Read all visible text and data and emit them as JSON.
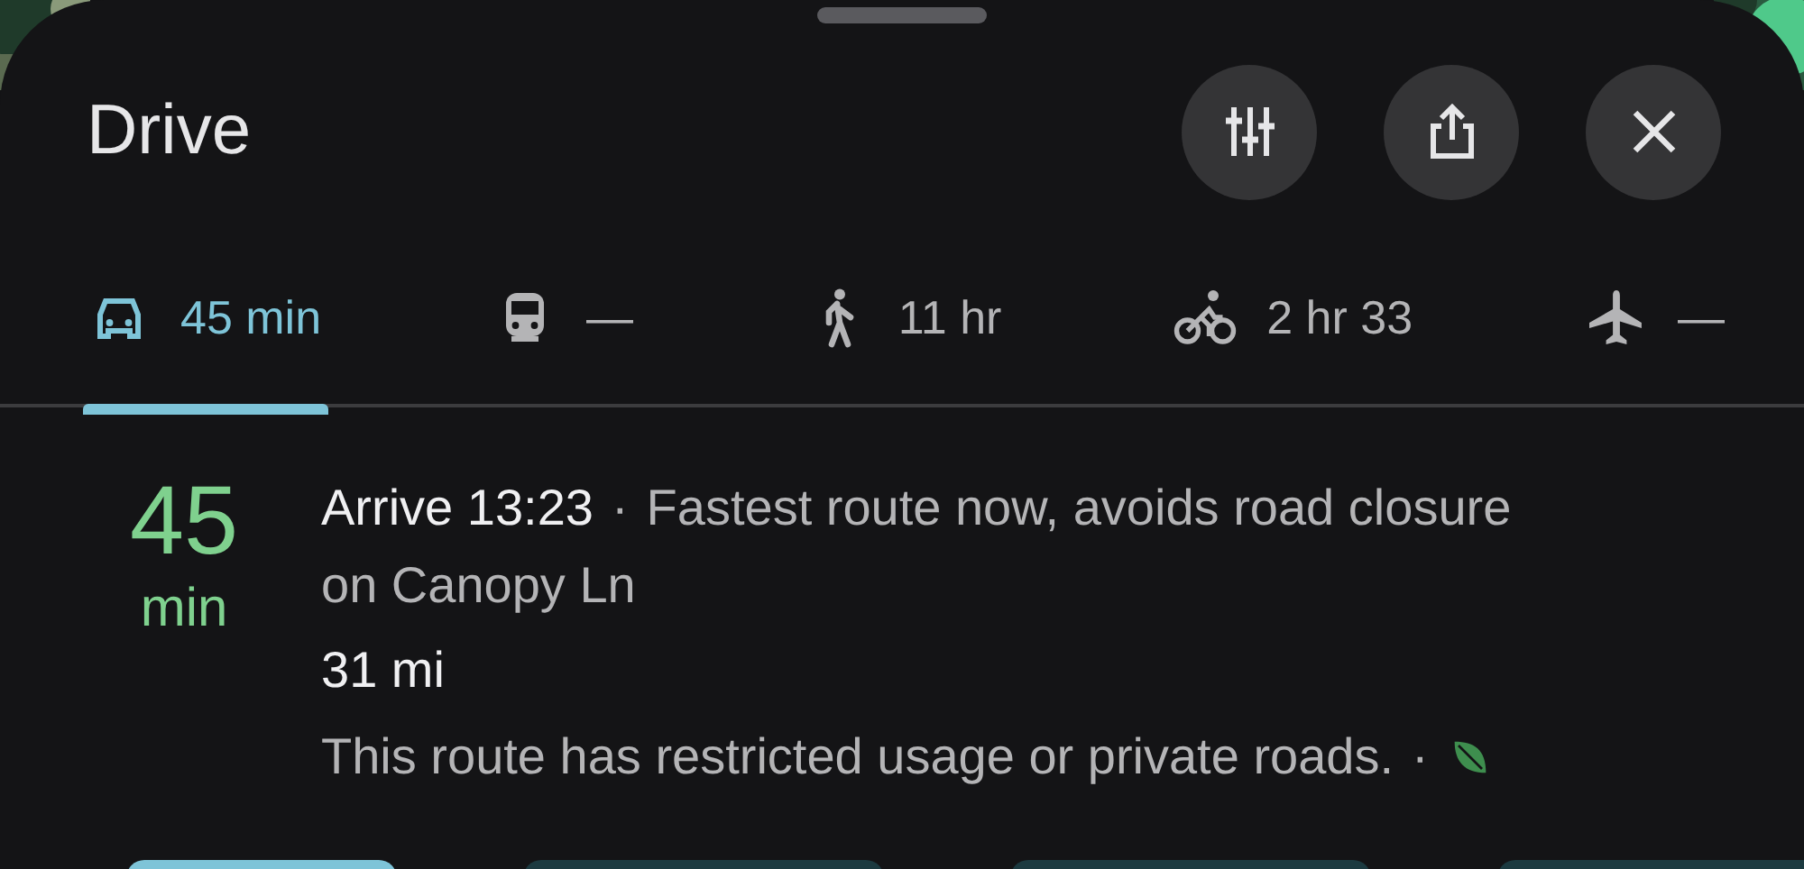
{
  "sheet": {
    "title": "Drive"
  },
  "header_buttons": [
    {
      "kind": "options"
    },
    {
      "kind": "share"
    },
    {
      "kind": "close"
    }
  ],
  "tabs": [
    {
      "kind": "car",
      "label": "45 min",
      "selected": true
    },
    {
      "kind": "transit",
      "label": "—",
      "selected": false
    },
    {
      "kind": "walk",
      "label": "11 hr",
      "selected": false
    },
    {
      "kind": "bike",
      "label": "2 hr 33",
      "selected": false
    },
    {
      "kind": "flight",
      "label": "—",
      "selected": false
    }
  ],
  "route": {
    "duration": "45",
    "duration_unit": "min",
    "arrive": "Arrive 13:23",
    "separator": "·",
    "description": "Fastest route now, avoids road closure on Canopy Ln",
    "distance": "31 mi",
    "note": "This route has restricted usage or private roads.",
    "note_separator": "·",
    "eco": true
  },
  "action_buttons": [
    {
      "primary": true
    },
    {
      "primary": false
    },
    {
      "primary": false
    },
    {
      "primary": false
    }
  ]
}
